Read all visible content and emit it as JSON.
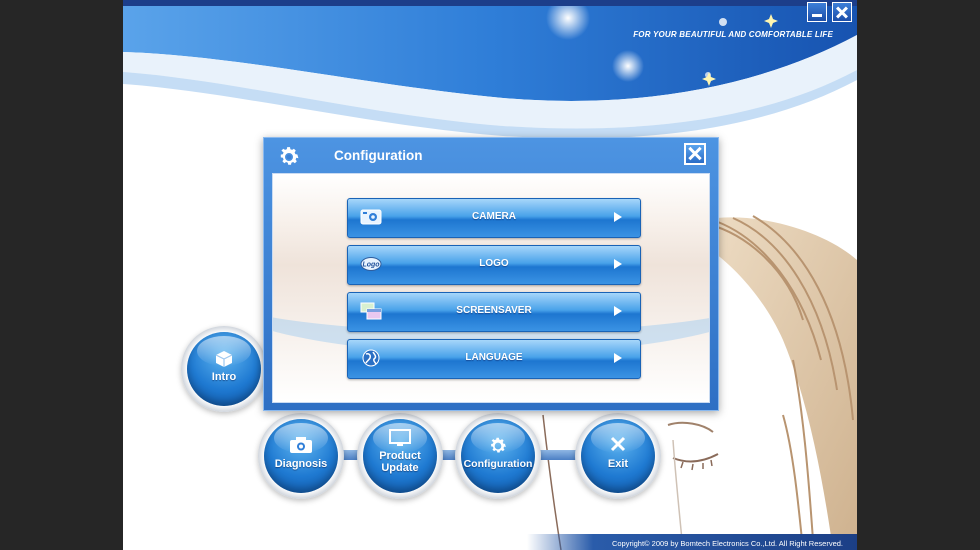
{
  "header": {
    "tagline": "FOR YOUR BEAUTIFUL AND COMFORTABLE LIFE"
  },
  "window_controls": {
    "minimize_icon": "minimize-icon",
    "close_icon": "close-icon"
  },
  "dialog": {
    "title": "Configuration",
    "icon": "gear-icon",
    "close_icon": "close-icon",
    "items": [
      {
        "label": "CAMERA",
        "icon": "camera-icon"
      },
      {
        "label": "LOGO",
        "icon": "logo-icon",
        "icon_text": "Logo"
      },
      {
        "label": "SCREENSAVER",
        "icon": "screensaver-icon"
      },
      {
        "label": "LANGUAGE",
        "icon": "globe-icon"
      }
    ]
  },
  "nav": [
    {
      "label": "Intro",
      "icon": "box-icon"
    },
    {
      "label": "Diagnosis",
      "icon": "camera-icon"
    },
    {
      "label": "Product Update",
      "icon": "monitor-icon"
    },
    {
      "label": "Configuration",
      "icon": "gear-icon"
    },
    {
      "label": "Exit",
      "icon": "close-icon"
    }
  ],
  "footer": {
    "copyright": "Copyright© 2009 by Bomtech Electronics Co.,Ltd.  All Right Reserved."
  },
  "colors": {
    "header_blue": "#2f7ed8",
    "dialog_blue": "#3d82d6",
    "button_blue": "#1f7ad2",
    "background_dark": "#262626"
  }
}
